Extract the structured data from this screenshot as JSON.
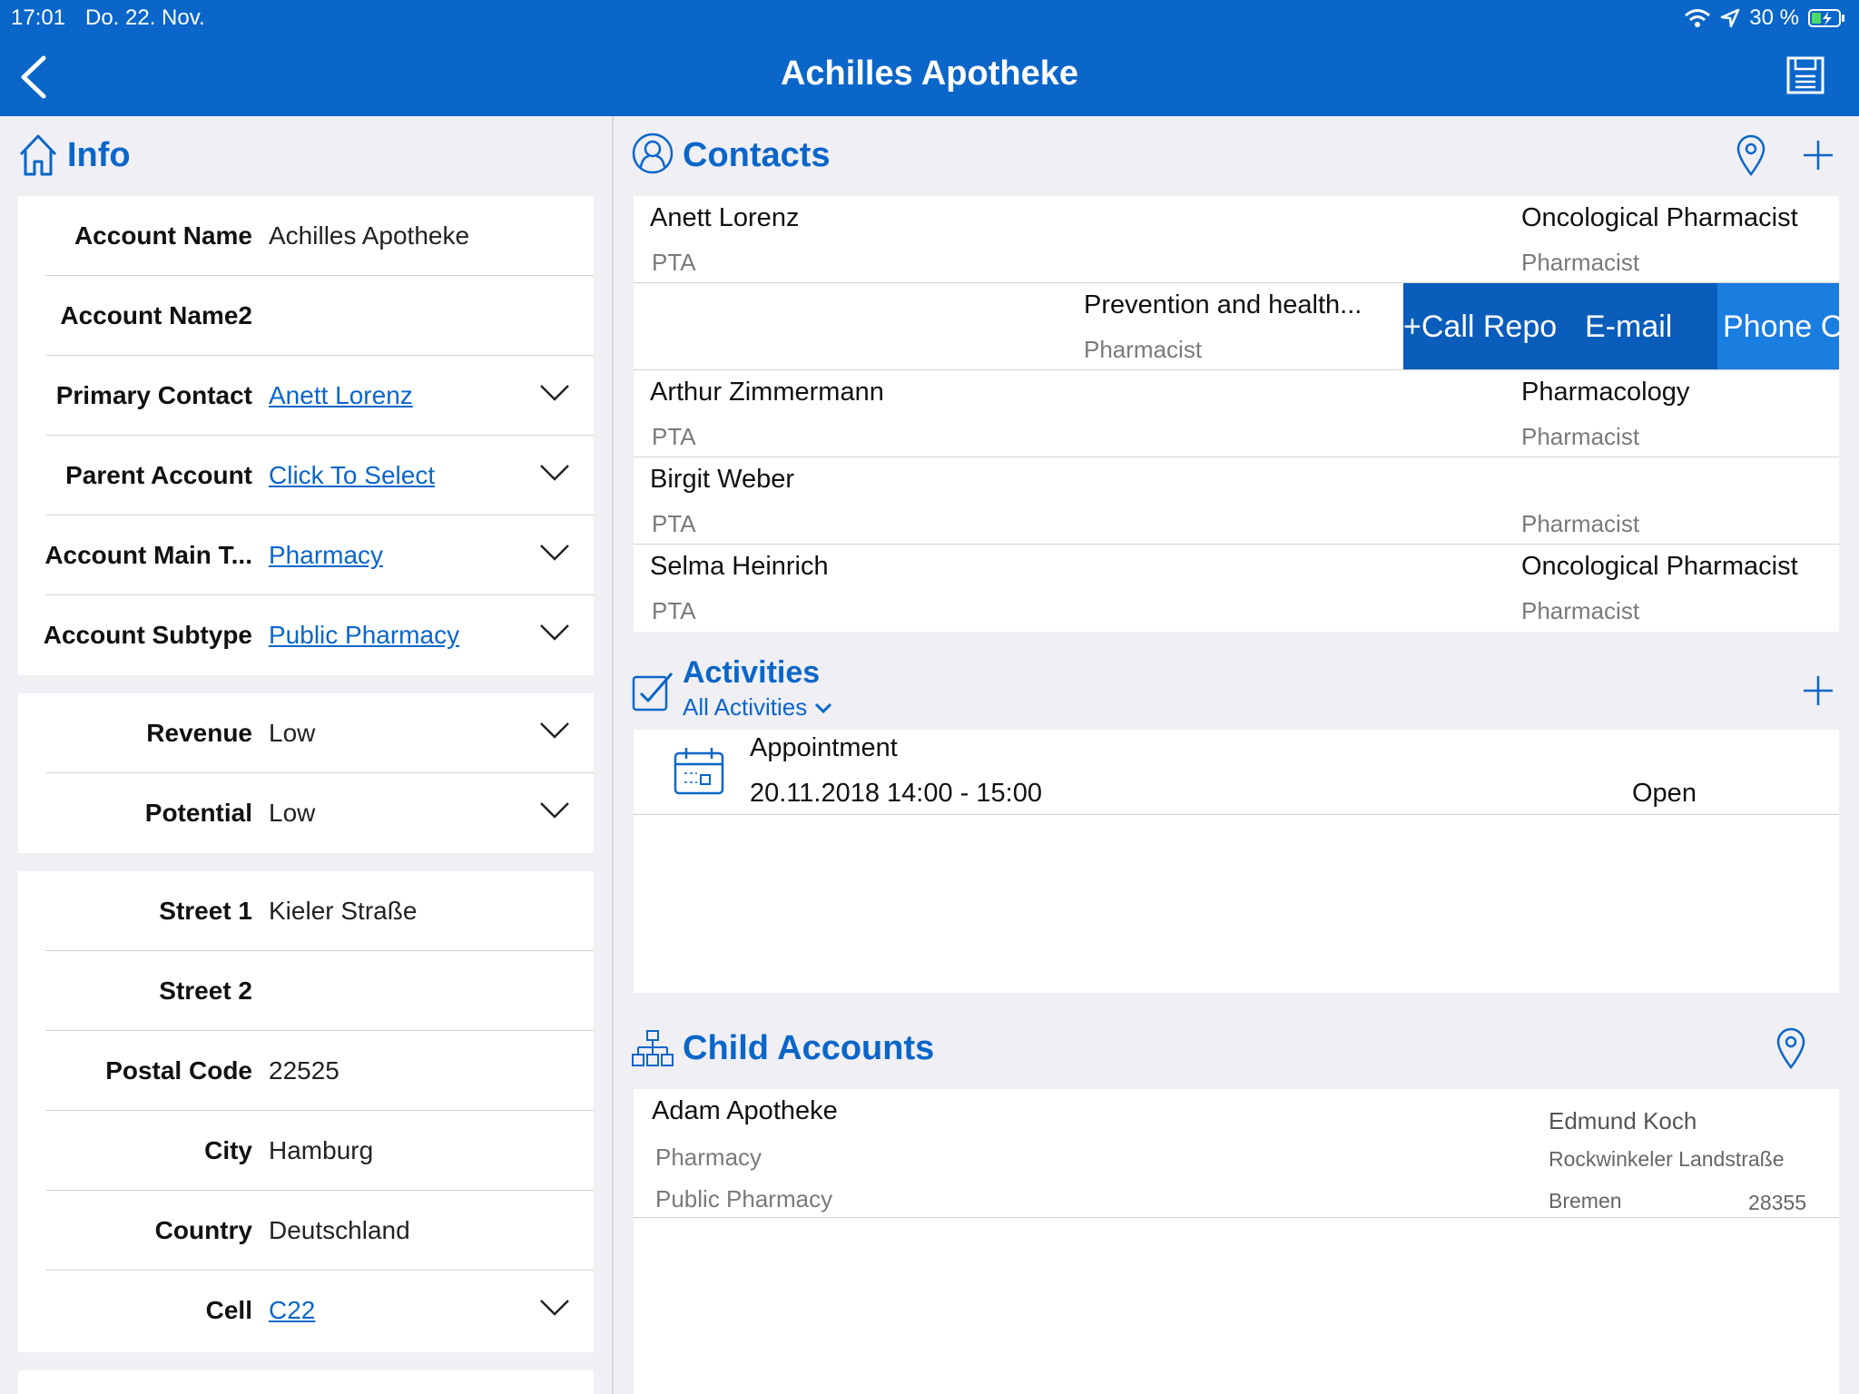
{
  "status": {
    "time": "17:01",
    "date": "Do. 22. Nov.",
    "battery": "30 %"
  },
  "nav": {
    "title": "Achilles Apotheke"
  },
  "info": {
    "title": "Info",
    "group1": [
      {
        "label": "Account Name",
        "value": "Achilles Apotheke"
      },
      {
        "label": "Account Name2",
        "value": ""
      },
      {
        "label": "Primary Contact",
        "value": "Anett Lorenz"
      },
      {
        "label": "Parent Account",
        "value": "Click To Select"
      },
      {
        "label": "Account Main T...",
        "value": "Pharmacy"
      },
      {
        "label": "Account Subtype",
        "value": "Public Pharmacy"
      }
    ],
    "group2": [
      {
        "label": "Revenue",
        "value": "Low"
      },
      {
        "label": "Potential",
        "value": "Low"
      }
    ],
    "group3": [
      {
        "label": "Street 1",
        "value": "Kieler Straße"
      },
      {
        "label": "Street 2",
        "value": ""
      },
      {
        "label": "Postal Code",
        "value": "22525"
      },
      {
        "label": "City",
        "value": "Hamburg"
      },
      {
        "label": "Country",
        "value": "Deutschland"
      },
      {
        "label": "Cell",
        "value": "C22"
      }
    ]
  },
  "contacts": {
    "title": "Contacts",
    "rows": [
      {
        "name": "Anett Lorenz",
        "sub": "PTA",
        "spec": "Oncological Pharmacist",
        "role": "Pharmacist"
      },
      {
        "name": "",
        "sub": "",
        "spec": "Prevention and health...",
        "role": "Pharmacist"
      },
      {
        "name": "Arthur Zimmermann",
        "sub": "PTA",
        "spec": "Pharmacology",
        "role": "Pharmacist"
      },
      {
        "name": "Birgit Weber",
        "sub": "PTA",
        "spec": "",
        "role": "Pharmacist"
      },
      {
        "name": "Selma Heinrich",
        "sub": "PTA",
        "spec": "Oncological Pharmacist",
        "role": "Pharmacist"
      }
    ],
    "swipe_actions": {
      "call_report": "+Call Repo",
      "email": "E-mail",
      "phone_call": "Phone Cal"
    }
  },
  "activities": {
    "title": "Activities",
    "filter": "All Activities",
    "items": [
      {
        "type": "Appointment",
        "datetime": "20.11.2018 14:00 - 15:00",
        "status": "Open"
      }
    ]
  },
  "child_accounts": {
    "title": "Child Accounts",
    "items": [
      {
        "name": "Adam Apotheke",
        "type": "Pharmacy",
        "subtype": "Public Pharmacy",
        "contact": "Edmund Koch",
        "street": "Rockwinkeler Landstraße",
        "city": "Bremen",
        "postal": "28355"
      }
    ]
  },
  "colors": {
    "accent": "#0a66c9",
    "background": "#efeff4"
  }
}
